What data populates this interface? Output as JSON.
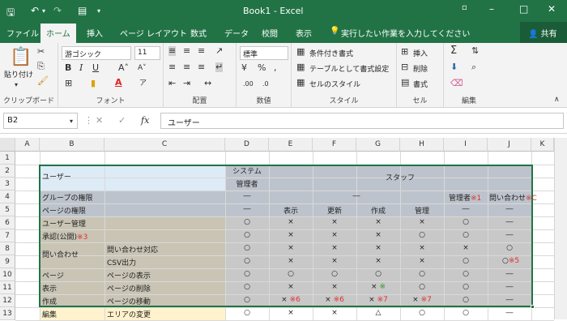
{
  "title_bar": {
    "doc_title": "Book1 - Excel"
  },
  "tabs": [
    "ファイル",
    "ホーム",
    "挿入",
    "ページ レイアウト",
    "数式",
    "データ",
    "校閲",
    "表示"
  ],
  "tell_me": "実行したい作業を入力してください",
  "share": "共有",
  "ribbon": {
    "clipboard": {
      "paste": "貼り付け",
      "label": "クリップボード"
    },
    "font": {
      "name": "游ゴシック",
      "size": "11",
      "label": "フォント"
    },
    "alignment": {
      "label": "配置"
    },
    "number": {
      "format": "標準",
      "label": "数値"
    },
    "styles": {
      "cond": "条件付き書式",
      "table": "テーブルとして書式設定",
      "cell": "セルのスタイル",
      "label": "スタイル"
    },
    "cells": {
      "insert": "挿入",
      "delete": "削除",
      "format": "書式",
      "label": "セル"
    },
    "editing": {
      "label": "編集"
    }
  },
  "formula_bar": {
    "name_box": "B2",
    "fx": "fx",
    "content": "ユーザー"
  },
  "columns": [
    "A",
    "B",
    "C",
    "D",
    "E",
    "F",
    "G",
    "H",
    "I",
    "J",
    "K"
  ],
  "rows": [
    "1",
    "2",
    "3",
    "4",
    "5",
    "6",
    "7",
    "8",
    "9",
    "10",
    "11",
    "12",
    "13"
  ],
  "cells": {
    "b2": "ユーザー",
    "d2": "システム",
    "d3": "管理者",
    "g2": "スタッフ",
    "b4": "グループの権限",
    "d4": "―",
    "f4": "―",
    "i4": "管理者",
    "i4n": "※1",
    "j4": "問い合わせ",
    "j4n": "※C",
    "b5": "ページの権限",
    "d5": "―",
    "e5": "表示",
    "f5": "更新",
    "g5": "作成",
    "h5": "管理",
    "i5": "―",
    "j5": "―",
    "b6": "ユーザー管理",
    "d6": "○",
    "e6": "×",
    "f6": "×",
    "g6": "×",
    "h6": "×",
    "i6": "○",
    "j6": "―",
    "b7": "承認(公開)",
    "b7n": "※3",
    "d7": "○",
    "e7": "×",
    "f7": "×",
    "g7": "×",
    "h7": "○",
    "i7": "○",
    "j7": "―",
    "b8": "問い合わせ",
    "c8": "問い合わせ対応",
    "d8": "○",
    "e8": "×",
    "f8": "×",
    "g8": "×",
    "h8": "×",
    "i8": "×",
    "j8": "○",
    "c9": "CSV出力",
    "d9": "○",
    "e9": "×",
    "f9": "×",
    "g9": "×",
    "h9": "×",
    "i9": "○",
    "j9": "○",
    "j9n": "※5",
    "b10": "ページ",
    "c10": "ページの表示",
    "d10": "○",
    "e10": "○",
    "f10": "○",
    "g10": "○",
    "h10": "○",
    "i10": "○",
    "j10": "―",
    "b11": "表示",
    "c11": "ページの削除",
    "d11": "○",
    "e11": "×",
    "f11": "×",
    "g11": "×",
    "g11n": "※",
    "h11": "○",
    "i11": "○",
    "j11": "―",
    "b12": "作成",
    "c12": "ページの移動",
    "d12": "○",
    "e12": "×",
    "e12n": "※6",
    "f12": "×",
    "f12n": "※6",
    "g12": "×",
    "g12n": "※7",
    "h12": "×",
    "h12n": "※7",
    "i12": "○",
    "j12": "―",
    "b13": "編集",
    "c13": "エリアの変更",
    "d13": "○",
    "e13": "×",
    "f13": "×",
    "g13": "△",
    "h13": "○",
    "i13": "○",
    "j13": "―"
  },
  "colors": {
    "excel_green": "#217346",
    "header_blue": "#ddebf7",
    "gray_band": "#bdc3cc",
    "tan_band": "#c9c4b4",
    "light_tan": "#fff2cc"
  }
}
